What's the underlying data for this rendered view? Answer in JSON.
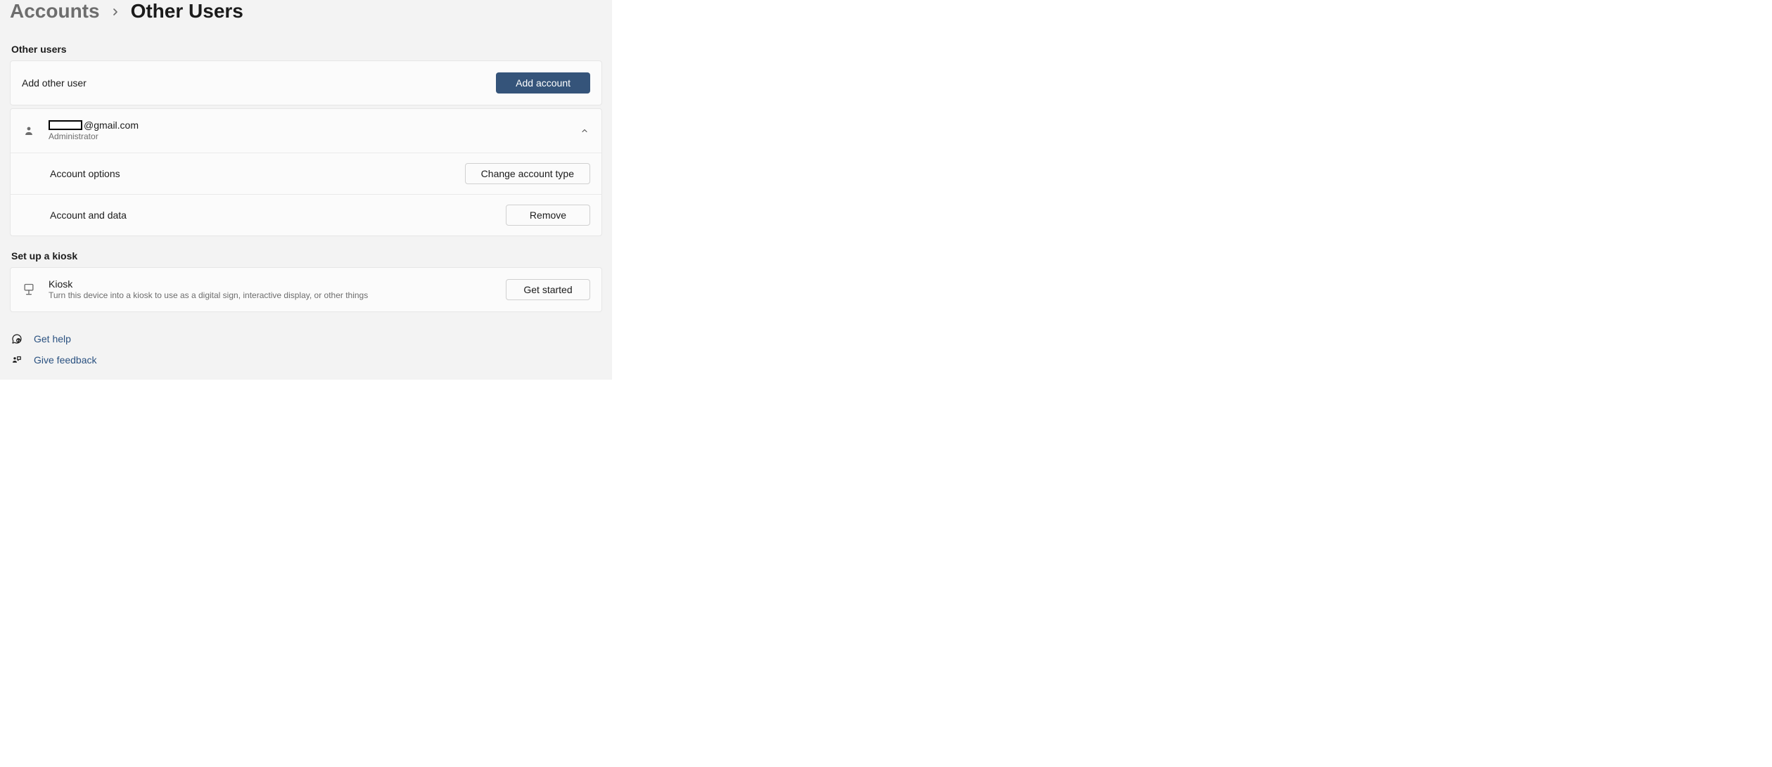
{
  "breadcrumb": {
    "parent": "Accounts",
    "current": "Other Users"
  },
  "sections": {
    "other_users_title": "Other users",
    "kiosk_title": "Set up a kiosk"
  },
  "add_user": {
    "label": "Add other user",
    "button": "Add account"
  },
  "user": {
    "email_suffix": "@gmail.com",
    "role": "Administrator",
    "account_options_label": "Account options",
    "change_type_button": "Change account type",
    "account_data_label": "Account and data",
    "remove_button": "Remove"
  },
  "kiosk": {
    "title": "Kiosk",
    "description": "Turn this device into a kiosk to use as a digital sign, interactive display, or other things",
    "button": "Get started"
  },
  "links": {
    "help": "Get help",
    "feedback": "Give feedback"
  }
}
